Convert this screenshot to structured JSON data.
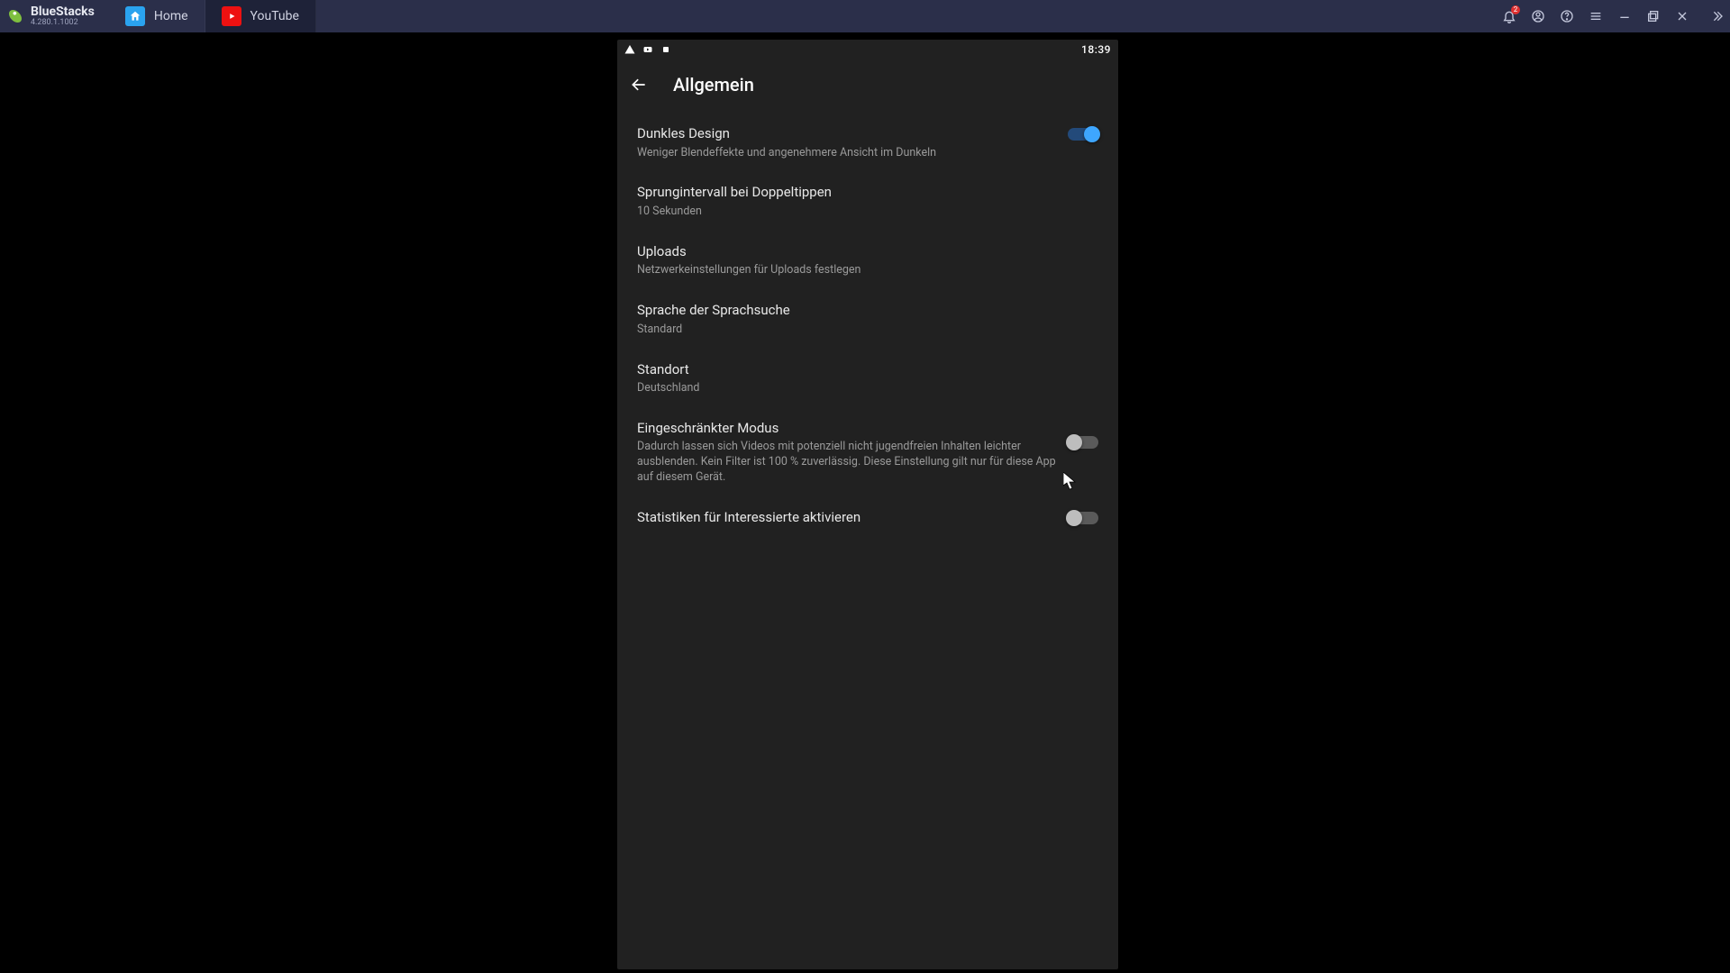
{
  "bluestacks": {
    "brand": "BlueStacks",
    "version": "4.280.1.1002",
    "tabs": [
      {
        "label": "Home"
      },
      {
        "label": "YouTube"
      }
    ],
    "notification_count": "2"
  },
  "status_bar": {
    "time": "18:39"
  },
  "app_bar": {
    "title": "Allgemein"
  },
  "settings": {
    "dark_design": {
      "title": "Dunkles Design",
      "sub": "Weniger Blendeffekte und angenehmere Ansicht im Dunkeln",
      "on": true
    },
    "double_tap": {
      "title": "Sprungintervall bei Doppeltippen",
      "sub": "10 Sekunden"
    },
    "uploads": {
      "title": "Uploads",
      "sub": "Netzwerkeinstellungen für Uploads festlegen"
    },
    "voice_lang": {
      "title": "Sprache der Sprachsuche",
      "sub": "Standard"
    },
    "location": {
      "title": "Standort",
      "sub": "Deutschland"
    },
    "restricted": {
      "title": "Eingeschränkter Modus",
      "sub": "Dadurch lassen sich Videos mit potenziell nicht jugendfreien Inhalten leichter ausblenden. Kein Filter ist 100 % zuverlässig. Diese Einstellung gilt nur für diese App auf diesem Gerät.",
      "on": false
    },
    "stats": {
      "title": "Statistiken für Interessierte aktivieren",
      "on": false
    }
  }
}
